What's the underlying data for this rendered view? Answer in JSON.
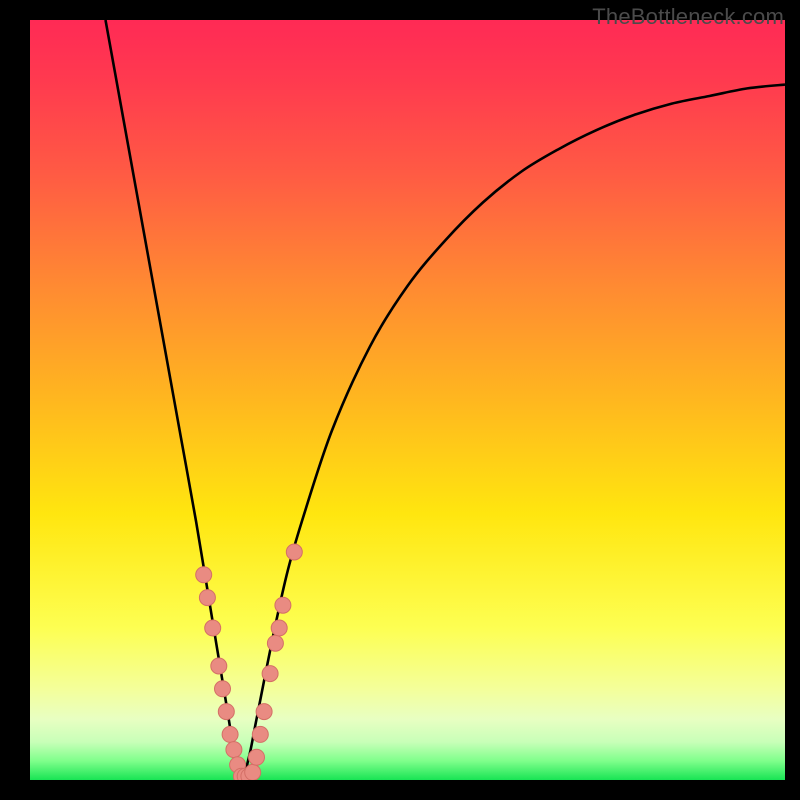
{
  "watermark": "TheBottleneck.com",
  "colors": {
    "frame": "#000000",
    "curve": "#000000",
    "marker_fill": "#e98b82",
    "marker_stroke": "#d46f66"
  },
  "chart_data": {
    "type": "line",
    "title": "",
    "xlabel": "",
    "ylabel": "",
    "xlim": [
      0,
      100
    ],
    "ylim": [
      0,
      100
    ],
    "grid": false,
    "curve": {
      "description": "V-shaped bottleneck curve; minimum ≈0 near x≈28",
      "x": [
        10,
        12,
        14,
        16,
        18,
        20,
        22,
        24,
        26,
        27,
        28,
        29,
        30,
        32,
        34,
        36,
        40,
        45,
        50,
        55,
        60,
        65,
        70,
        75,
        80,
        85,
        90,
        95,
        100
      ],
      "y": [
        100,
        89,
        78,
        67,
        56,
        45,
        34,
        22,
        10,
        4,
        0,
        3,
        8,
        18,
        27,
        34,
        46,
        57,
        65,
        71,
        76,
        80,
        83,
        85.5,
        87.5,
        89,
        90,
        91,
        91.5
      ]
    },
    "markers": {
      "description": "Highlighted points clustered on the lower arms of the V",
      "points": [
        {
          "x": 23.0,
          "y": 27
        },
        {
          "x": 23.5,
          "y": 24
        },
        {
          "x": 24.2,
          "y": 20
        },
        {
          "x": 25.0,
          "y": 15
        },
        {
          "x": 25.5,
          "y": 12
        },
        {
          "x": 26.0,
          "y": 9
        },
        {
          "x": 26.5,
          "y": 6
        },
        {
          "x": 27.0,
          "y": 4
        },
        {
          "x": 27.5,
          "y": 2
        },
        {
          "x": 28.0,
          "y": 0.5
        },
        {
          "x": 28.5,
          "y": 0.5
        },
        {
          "x": 29.0,
          "y": 0.5
        },
        {
          "x": 29.5,
          "y": 1
        },
        {
          "x": 30.0,
          "y": 3
        },
        {
          "x": 30.5,
          "y": 6
        },
        {
          "x": 31.0,
          "y": 9
        },
        {
          "x": 31.8,
          "y": 14
        },
        {
          "x": 32.5,
          "y": 18
        },
        {
          "x": 33.0,
          "y": 20
        },
        {
          "x": 33.5,
          "y": 23
        },
        {
          "x": 35.0,
          "y": 30
        }
      ]
    }
  }
}
